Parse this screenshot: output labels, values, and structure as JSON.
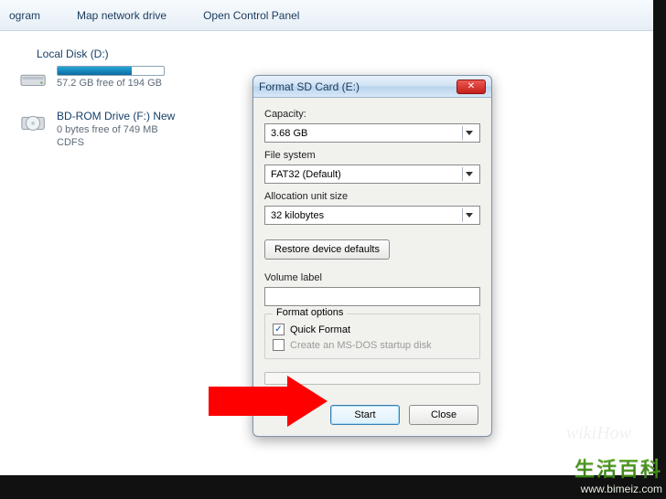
{
  "toolbar": {
    "item0": "ogram",
    "item1": "Map network drive",
    "item2": "Open Control Panel"
  },
  "drives": {
    "local_d": {
      "heading": "Local Disk (D:)",
      "free_text": "57.2 GB free of 194 GB",
      "fill_pct": 70
    },
    "bdrom_f": {
      "heading": "BD-ROM Drive (F:) New",
      "free_text": "0 bytes free of 749 MB",
      "fs": "CDFS"
    }
  },
  "dialog": {
    "title": "Format SD Card (E:)",
    "capacity": {
      "label": "Capacity:",
      "value": "3.68 GB"
    },
    "file_system": {
      "label": "File system",
      "value": "FAT32 (Default)"
    },
    "alloc": {
      "label": "Allocation unit size",
      "value": "32 kilobytes"
    },
    "restore_btn": "Restore device defaults",
    "volume_label": {
      "label": "Volume label",
      "value": ""
    },
    "format_options": {
      "caption": "Format options",
      "quick_format": {
        "label": "Quick Format",
        "checked": true
      },
      "msdos": {
        "label": "Create an MS-DOS startup disk",
        "checked": false,
        "enabled": false
      }
    },
    "buttons": {
      "start": "Start",
      "close": "Close"
    }
  },
  "watermark": {
    "cn": "生活百科",
    "url": "www.bimeiz.com"
  },
  "wikihow": "wikiHow"
}
